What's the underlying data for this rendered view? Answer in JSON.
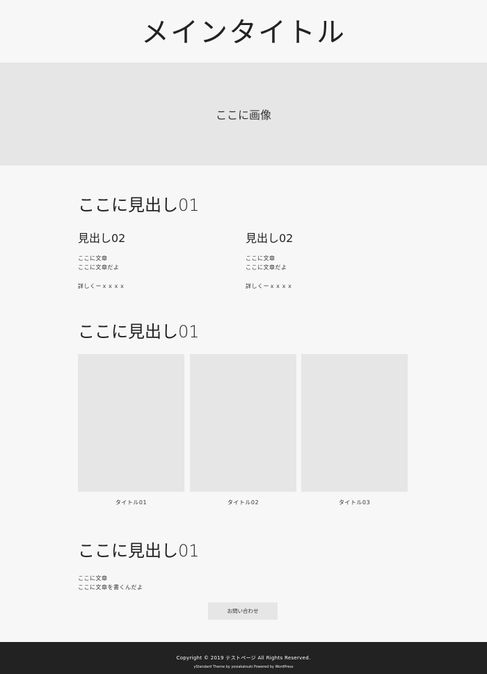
{
  "site": {
    "title": "メインタイトル"
  },
  "hero": {
    "text": "ここに画像"
  },
  "section1": {
    "heading": "ここに見出し01",
    "columns": [
      {
        "heading": "見出し02",
        "line1": "ここに文章",
        "line2": "ここに文章だよ",
        "more": "詳しくーｘｘｘｘ"
      },
      {
        "heading": "見出し02",
        "line1": "ここに文章",
        "line2": "ここに文章だよ",
        "more": "詳しくーｘｘｘｘ"
      }
    ]
  },
  "section2": {
    "heading": "ここに見出し01",
    "cards": [
      {
        "title": "タイトル01"
      },
      {
        "title": "タイトル02"
      },
      {
        "title": "タイトル03"
      }
    ]
  },
  "section3": {
    "heading": "ここに見出し01",
    "line1": "ここに文章",
    "line2": "ここに文章を書くんだよ",
    "contact_label": "お問い合わせ"
  },
  "footer": {
    "copyright": "Copyright © 2019 テストページ All Rights Reserved.",
    "powered": "yStandard Theme by yosiakatsuki Powered by WordPress"
  },
  "colors": {
    "background": "#f7f7f7",
    "placeholder": "#e6e6e6",
    "footer": "#222222"
  }
}
